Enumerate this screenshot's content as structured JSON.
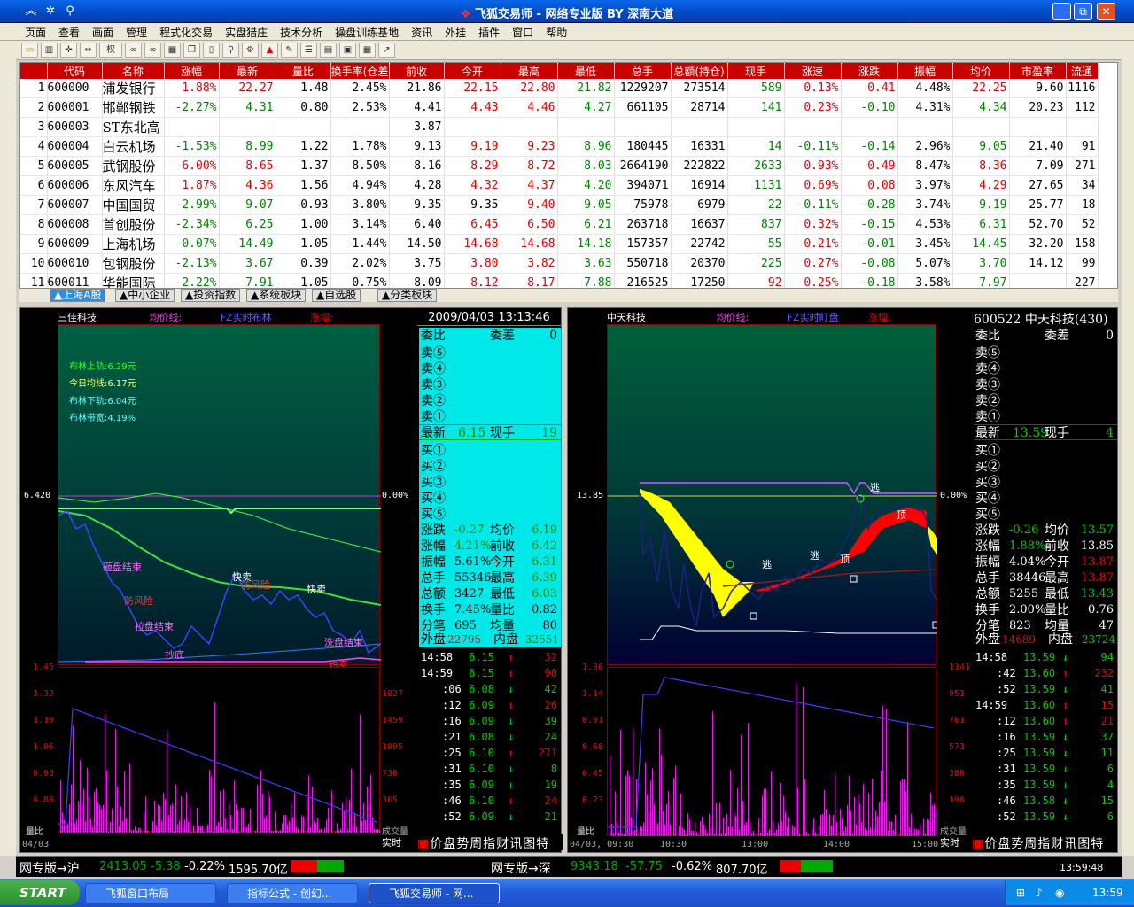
{
  "window": {
    "title": "飞狐交易师 - 网络专业版 BY 深南大道",
    "min": "—",
    "max": "⧉",
    "close": "✕"
  },
  "menu": [
    "页面",
    "查看",
    "画面",
    "管理",
    "程式化交易",
    "实盘猎庄",
    "技术分析",
    "操盘训练基地",
    "资讯",
    "外挂",
    "插件",
    "窗口",
    "帮助"
  ],
  "toolbar": {
    "weight_label": "权"
  },
  "table": {
    "headers": [
      "",
      "代码",
      "名称",
      "涨幅",
      "最新",
      "量比",
      "换手率(仓差",
      "前收",
      "今开",
      "最高",
      "最低",
      "总手",
      "总额(持仓)",
      "现手",
      "涨速",
      "涨跌",
      "振幅",
      "均价",
      "市盈率",
      "流通"
    ],
    "rows": [
      {
        "n": "1",
        "code": "600000",
        "name": "浦发银行",
        "chg": "1.88%",
        "last": "22.27",
        "vr": "1.48",
        "turn": "2.45%",
        "prev": "21.86",
        "open": "22.15",
        "high": "22.80",
        "low": "21.82",
        "vol": "1229207",
        "amt": "273514",
        "cur": "589",
        "spd": "0.13%",
        "diff": "0.41",
        "amp": "4.48%",
        "avg": "22.25",
        "pe": "9.60",
        "flt": "1116",
        "dir": "r"
      },
      {
        "n": "2",
        "code": "600001",
        "name": "邯郸钢铁",
        "chg": "-2.27%",
        "last": "4.31",
        "vr": "0.80",
        "turn": "2.53%",
        "prev": "4.41",
        "open": "4.43",
        "high": "4.46",
        "low": "4.27",
        "vol": "661105",
        "amt": "28714",
        "cur": "141",
        "spd": "0.23%",
        "diff": "-0.10",
        "amp": "4.31%",
        "avg": "4.34",
        "pe": "20.23",
        "flt": "112",
        "dir": "g"
      },
      {
        "n": "3",
        "code": "600003",
        "name": "ST东北高",
        "chg": "",
        "last": "",
        "vr": "",
        "turn": "",
        "prev": "3.87",
        "open": "",
        "high": "",
        "low": "",
        "vol": "",
        "amt": "",
        "cur": "",
        "spd": "",
        "diff": "",
        "amp": "",
        "avg": "",
        "pe": "",
        "flt": "",
        "dir": "k"
      },
      {
        "n": "4",
        "code": "600004",
        "name": "白云机场",
        "chg": "-1.53%",
        "last": "8.99",
        "vr": "1.22",
        "turn": "1.78%",
        "prev": "9.13",
        "open": "9.19",
        "high": "9.23",
        "low": "8.96",
        "vol": "180445",
        "amt": "16331",
        "cur": "14",
        "spd": "-0.11%",
        "diff": "-0.14",
        "amp": "2.96%",
        "avg": "9.05",
        "pe": "21.40",
        "flt": "91",
        "dir": "g"
      },
      {
        "n": "5",
        "code": "600005",
        "name": "武钢股份",
        "chg": "6.00%",
        "last": "8.65",
        "vr": "1.37",
        "turn": "8.50%",
        "prev": "8.16",
        "open": "8.29",
        "high": "8.72",
        "low": "8.03",
        "vol": "2664190",
        "amt": "222822",
        "cur": "2633",
        "spd": "0.93%",
        "diff": "0.49",
        "amp": "8.47%",
        "avg": "8.36",
        "pe": "7.09",
        "flt": "271",
        "dir": "r"
      },
      {
        "n": "6",
        "code": "600006",
        "name": "东风汽车",
        "chg": "1.87%",
        "last": "4.36",
        "vr": "1.56",
        "turn": "4.94%",
        "prev": "4.28",
        "open": "4.32",
        "high": "4.37",
        "low": "4.20",
        "vol": "394071",
        "amt": "16914",
        "cur": "1131",
        "spd": "0.69%",
        "diff": "0.08",
        "amp": "3.97%",
        "avg": "4.29",
        "pe": "27.65",
        "flt": "34",
        "dir": "r"
      },
      {
        "n": "7",
        "code": "600007",
        "name": "中国国贸",
        "chg": "-2.99%",
        "last": "9.07",
        "vr": "0.93",
        "turn": "3.80%",
        "prev": "9.35",
        "open": "9.35",
        "high": "9.40",
        "low": "9.05",
        "vol": "75978",
        "amt": "6979",
        "cur": "22",
        "spd": "-0.11%",
        "diff": "-0.28",
        "amp": "3.74%",
        "avg": "9.19",
        "pe": "25.77",
        "flt": "18",
        "dir": "g"
      },
      {
        "n": "8",
        "code": "600008",
        "name": "首创股份",
        "chg": "-2.34%",
        "last": "6.25",
        "vr": "1.00",
        "turn": "3.14%",
        "prev": "6.40",
        "open": "6.45",
        "high": "6.50",
        "low": "6.21",
        "vol": "263718",
        "amt": "16637",
        "cur": "837",
        "spd": "0.32%",
        "diff": "-0.15",
        "amp": "4.53%",
        "avg": "6.31",
        "pe": "52.70",
        "flt": "52",
        "dir": "g"
      },
      {
        "n": "9",
        "code": "600009",
        "name": "上海机场",
        "chg": "-0.07%",
        "last": "14.49",
        "vr": "1.05",
        "turn": "1.44%",
        "prev": "14.50",
        "open": "14.68",
        "high": "14.68",
        "low": "14.18",
        "vol": "157357",
        "amt": "22742",
        "cur": "55",
        "spd": "0.21%",
        "diff": "-0.01",
        "amp": "3.45%",
        "avg": "14.45",
        "pe": "32.20",
        "flt": "158",
        "dir": "g"
      },
      {
        "n": "10",
        "code": "600010",
        "name": "包钢股份",
        "chg": "-2.13%",
        "last": "3.67",
        "vr": "0.39",
        "turn": "2.02%",
        "prev": "3.75",
        "open": "3.80",
        "high": "3.82",
        "low": "3.63",
        "vol": "550718",
        "amt": "20370",
        "cur": "225",
        "spd": "0.27%",
        "diff": "-0.08",
        "amp": "5.07%",
        "avg": "3.70",
        "pe": "14.12",
        "flt": "99",
        "dir": "g"
      },
      {
        "n": "11",
        "code": "600011",
        "name": "华能国际",
        "chg": "-2.22%",
        "last": "7.91",
        "vr": "1.05",
        "turn": "0.75%",
        "prev": "8.09",
        "open": "8.12",
        "high": "8.17",
        "low": "7.88",
        "vol": "216525",
        "amt": "17250",
        "cur": "92",
        "spd": "0.25%",
        "diff": "-0.18",
        "amp": "3.58%",
        "avg": "7.97",
        "pe": "",
        "flt": "227",
        "dir": "g"
      }
    ]
  },
  "tabs": [
    "▲上海A股",
    "▲中小企业",
    "▲投资指数",
    "▲系统板块",
    "▲自选股",
    "▲分类板块"
  ],
  "left": {
    "stock": "三佳科技",
    "avg_label": "均价线:",
    "ind_label": "FZ实时布林",
    "zf_label": "涨幅:",
    "boll_up": "布林上轨:6.29元",
    "boll_avg": "今日均线:6.17元",
    "boll_low": "布林下轨:6.04元",
    "boll_width": "布林带宽:4.19%",
    "prev_close": "6.420",
    "pct0": "0.00%",
    "yaxis": [
      "6.420"
    ],
    "vol_axis": [
      "1.45",
      "1.32",
      "1.19",
      "1.06",
      "0.93",
      "0.80"
    ],
    "vol_right": [
      "1827",
      "1459",
      "1095",
      "730",
      "365"
    ],
    "lb_label": "量比",
    "cjl_label": "成交量",
    "date_label": "04/03",
    "marks": [
      "快卖",
      "快卖",
      "抄底",
      "砸盘结束",
      "砸盘结束",
      "拉盘结束",
      "洗盘结束",
      "洗盘结束",
      "拉盘结束",
      "抄底",
      "短卖",
      "知庄",
      "防风险",
      "防风险",
      "洗盘结束",
      "砸盘结束"
    ],
    "datetime": "2009/04/03 13:13:46",
    "book": {
      "wb": "委比",
      "wc": "委差",
      "wc_val": "0",
      "sells": [
        "卖⑤",
        "卖④",
        "卖③",
        "卖②",
        "卖①"
      ],
      "last_label": "最新",
      "last_val": "6.15",
      "cur_label": "现手",
      "cur_val": "19",
      "buys": [
        "买①",
        "买②",
        "买③",
        "买④",
        "买⑤"
      ],
      "stats": [
        [
          "涨跌",
          "-0.27",
          "均价",
          "6.19"
        ],
        [
          "涨幅",
          "4.21%",
          "前收",
          "6.42"
        ],
        [
          "振幅",
          "5.61%",
          "今开",
          "6.31"
        ],
        [
          "总手",
          "55346",
          "最高",
          "6.39"
        ],
        [
          "总额",
          "3427",
          "最低",
          "6.03"
        ],
        [
          "换手",
          "7.45%",
          "量比",
          "0.82"
        ],
        [
          "分笔",
          "695",
          "均量",
          "80"
        ]
      ],
      "outer_label": "外盘",
      "outer_val": "22795",
      "inner_label": "内盘",
      "inner_val": "32551"
    },
    "ticks": [
      [
        "14:58",
        "6.15",
        "↑",
        "32"
      ],
      [
        "14:59",
        "6.15",
        "↑",
        "90"
      ],
      [
        ":06",
        "6.08",
        "↓",
        "42"
      ],
      [
        ":12",
        "6.09",
        "↑",
        "26"
      ],
      [
        ":16",
        "6.09",
        "↓",
        "39"
      ],
      [
        ":21",
        "6.08",
        "↓",
        "24"
      ],
      [
        ":25",
        "6.10",
        "↑",
        "271"
      ],
      [
        ":31",
        "6.10",
        "↓",
        "8"
      ],
      [
        ":35",
        "6.09",
        "↓",
        "19"
      ],
      [
        ":46",
        "6.10",
        "↑",
        "24"
      ],
      [
        ":52",
        "6.09",
        "↓",
        "21"
      ]
    ],
    "bottom_tabs": "价盘势周指财讯图特解",
    "shishi": "实时"
  },
  "right": {
    "stock": "中天科技",
    "avg_label": "均价线:",
    "ind_label": "FZ实时盯盘",
    "zf_label": "涨幅:",
    "prev_close": "13.85",
    "pct0": "0.00%",
    "vol_axis": [
      "1.36",
      "1.14",
      "0.91",
      "0.68",
      "0.45",
      "0.23"
    ],
    "vol_right": [
      "1141",
      "951",
      "761",
      "571",
      "380",
      "190"
    ],
    "lb_label": "量比",
    "cjl_label": "成交量",
    "time_axis": [
      "04/03, 09:30",
      "10:30",
      "13:00",
      "14:00",
      "15:00"
    ],
    "marks": [
      "逃",
      "逃",
      "逃",
      "顶",
      "顶"
    ],
    "header": "600522 中天科技(430)",
    "book": {
      "wb": "委比",
      "wc": "委差",
      "wc_val": "0",
      "sells": [
        "卖⑤",
        "卖④",
        "卖③",
        "卖②",
        "卖①"
      ],
      "last_label": "最新",
      "last_val": "13.59",
      "cur_label": "现手",
      "cur_val": "4",
      "buys": [
        "买①",
        "买②",
        "买③",
        "买④",
        "买⑤"
      ],
      "stats": [
        [
          "涨跌",
          "-0.26",
          "均价",
          "13.57"
        ],
        [
          "涨幅",
          "1.88%",
          "前收",
          "13.85"
        ],
        [
          "振幅",
          "4.04%",
          "今开",
          "13.87"
        ],
        [
          "总手",
          "38446",
          "最高",
          "13.87"
        ],
        [
          "总额",
          "5255",
          "最低",
          "13.43"
        ],
        [
          "换手",
          "2.00%",
          "量比",
          "0.76"
        ],
        [
          "分笔",
          "823",
          "均量",
          "47"
        ]
      ],
      "outer_label": "外盘",
      "outer_val": "14689",
      "inner_label": "内盘",
      "inner_val": "23724"
    },
    "ticks": [
      [
        "14:58",
        "13.59",
        "↓",
        "94"
      ],
      [
        ":42",
        "13.60",
        "↑",
        "232"
      ],
      [
        ":52",
        "13.59",
        "↓",
        "41"
      ],
      [
        "14:59",
        "13.60",
        "↑",
        "15"
      ],
      [
        ":12",
        "13.60",
        "↑",
        "21"
      ],
      [
        ":16",
        "13.59",
        "↓",
        "37"
      ],
      [
        ":25",
        "13.59",
        "↓",
        "11"
      ],
      [
        ":31",
        "13.59",
        "↓",
        "6"
      ],
      [
        ":35",
        "13.59",
        "↓",
        "4"
      ],
      [
        ":46",
        "13.58",
        "↓",
        "15"
      ],
      [
        ":52",
        "13.59",
        "↓",
        "6"
      ]
    ],
    "bottom_tabs": "价盘势周指财讯图特解",
    "shishi": "实时"
  },
  "status": {
    "sh_label": "网专版→沪",
    "sh_val": "2413.05",
    "sh_chg": "-5.38",
    "sh_pct": "-0.22%",
    "sh_amt": "1595.70亿",
    "sz_label": "网专版→深",
    "sz_val": "9343.18",
    "sz_chg": "-57.75",
    "sz_pct": "-0.62%",
    "sz_amt": "807.70亿",
    "time": "13:59:48"
  },
  "taskbar": {
    "start": "START",
    "tasks": [
      "飞狐窗口布局",
      "指标公式 - 创幻...",
      "飞狐交易师 - 网..."
    ],
    "clock": "13:59"
  },
  "colors": {
    "up": "#e00000",
    "down": "#008000",
    "header_red": "#c80000",
    "cyan_book": "#00e0e0"
  }
}
